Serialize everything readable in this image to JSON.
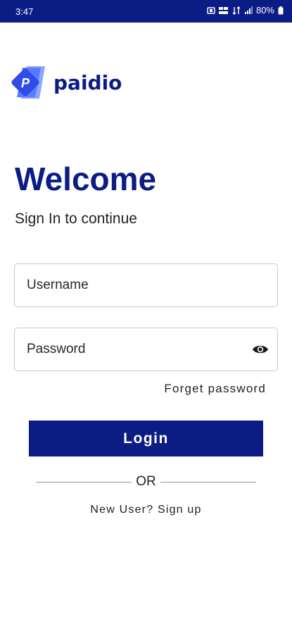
{
  "status_bar": {
    "time": "3:47",
    "battery": "80%"
  },
  "logo": {
    "text": "paidio",
    "mark_letter": "P"
  },
  "login": {
    "title": "Welcome",
    "subtitle": "Sign In to continue",
    "username_placeholder": "Username",
    "password_placeholder": "Password",
    "forget_password": "Forget password",
    "login_button": "Login",
    "or_text": "OR",
    "signup_text": "New User? Sign up"
  },
  "colors": {
    "brand": "#0b1d85",
    "logo_light": "#5b7bff",
    "logo_mid": "#2f4ce6"
  },
  "icons": {
    "password_toggle": "eye-icon"
  }
}
